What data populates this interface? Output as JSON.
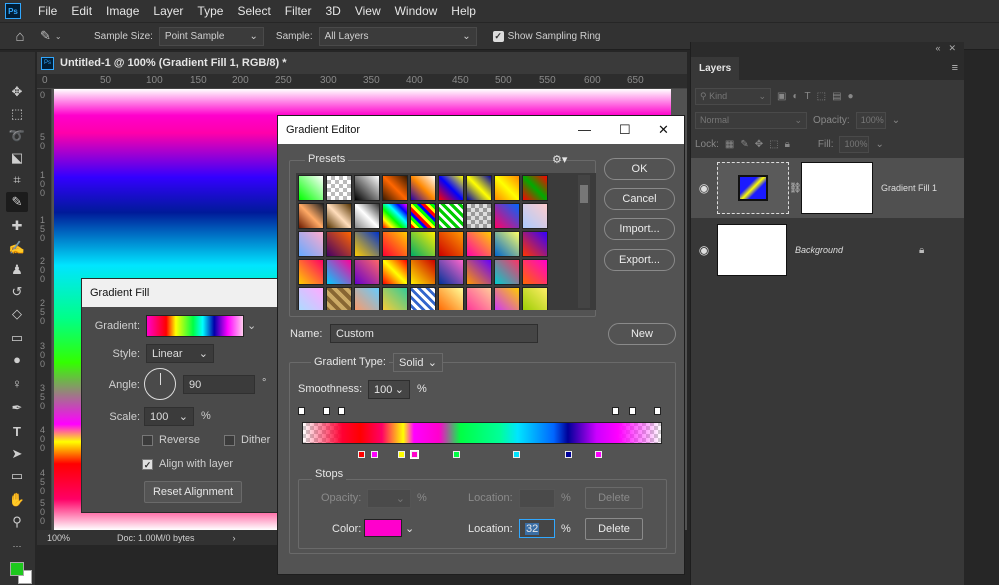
{
  "menubar": {
    "app_icon": "Ps",
    "items": [
      "File",
      "Edit",
      "Image",
      "Layer",
      "Type",
      "Select",
      "Filter",
      "3D",
      "View",
      "Window",
      "Help"
    ]
  },
  "options": {
    "sample_size_label": "Sample Size:",
    "sample_size_value": "Point Sample",
    "sample_label": "Sample:",
    "sample_value": "All Layers",
    "show_ring_label": "Show Sampling Ring"
  },
  "document": {
    "icon": "Ps",
    "title": "Untitled-1 @ 100% (Gradient Fill 1, RGB/8) *",
    "ruler_h": [
      "0",
      "50",
      "100",
      "150",
      "200",
      "250",
      "300",
      "350",
      "400",
      "450",
      "500",
      "550",
      "600",
      "650"
    ],
    "ruler_v": [
      "0",
      "5 0",
      "1 0 0",
      "1 5 0",
      "2 0 0",
      "2 5 0",
      "3 0 0",
      "3 5 0",
      "4 0 0",
      "4 5 0",
      "5 0 0"
    ],
    "zoom": "100%",
    "doc_info": "Doc: 1.00M/0 bytes"
  },
  "colors": {
    "foreground": "#1ec81e",
    "background": "#ffffff",
    "accent": "#31a8ff"
  },
  "layers_panel": {
    "tab": "Layers",
    "kind_label": "Kind",
    "blend_mode": "Normal",
    "opacity_label": "Opacity:",
    "opacity_value": "100%",
    "lock_label": "Lock:",
    "fill_label": "Fill:",
    "fill_value": "100%",
    "layers": [
      {
        "name": "Gradient Fill 1",
        "visible": true,
        "selected": true
      },
      {
        "name": "Background",
        "visible": true,
        "locked": true
      }
    ]
  },
  "gradient_fill": {
    "title": "Gradient Fill",
    "gradient_label": "Gradient:",
    "style_label": "Style:",
    "style_value": "Linear",
    "angle_label": "Angle:",
    "angle_value": "90",
    "angle_unit": "°",
    "scale_label": "Scale:",
    "scale_value": "100",
    "scale_unit": "%",
    "reverse_label": "Reverse",
    "dither_label": "Dither",
    "align_label": "Align with layer",
    "reset_label": "Reset Alignment",
    "reverse_checked": false,
    "dither_checked": false,
    "align_checked": true
  },
  "gradient_editor": {
    "title": "Gradient Editor",
    "presets_label": "Presets",
    "ok_label": "OK",
    "cancel_label": "Cancel",
    "import_label": "Import...",
    "export_label": "Export...",
    "name_label": "Name:",
    "name_value": "Custom",
    "new_label": "New",
    "type_label": "Gradient Type:",
    "type_value": "Solid",
    "smoothness_label": "Smoothness:",
    "smoothness_value": "100",
    "smoothness_unit": "%",
    "stops_label": "Stops",
    "opacity_label": "Opacity:",
    "opacity_unit": "%",
    "location_label": "Location:",
    "location_unit": "%",
    "delete_label": "Delete",
    "color_label": "Color:",
    "color_value": "#ff00cc",
    "color_location": "32"
  }
}
